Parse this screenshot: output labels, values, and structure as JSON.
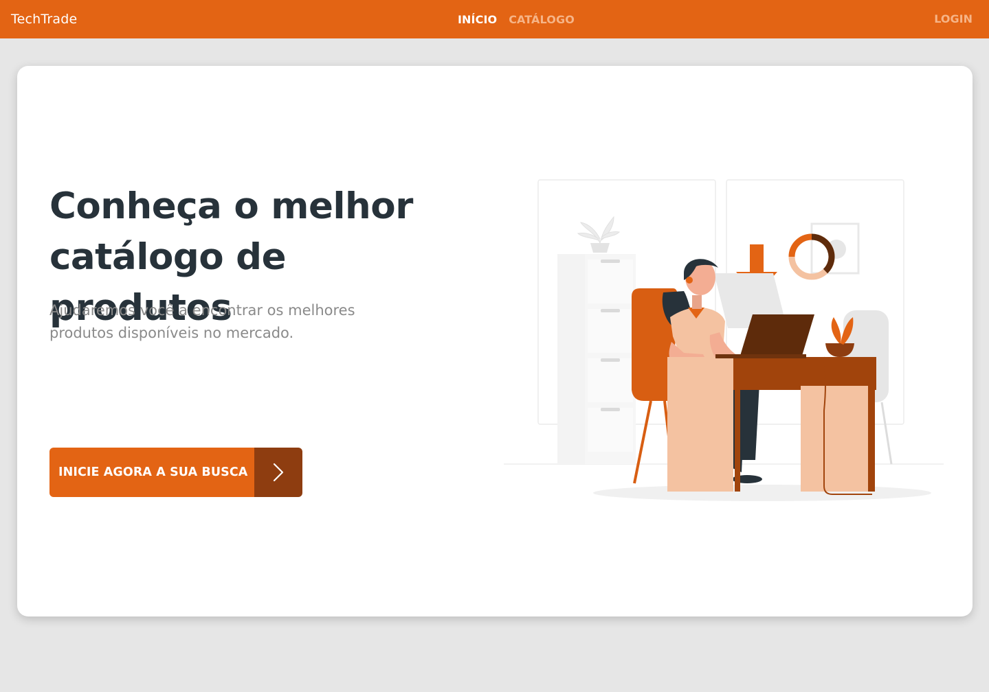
{
  "nav": {
    "brand": "TechTrade",
    "links": [
      {
        "label": "INÍCIO",
        "active": true
      },
      {
        "label": "CATÁLOGO",
        "active": false
      }
    ],
    "login_label": "LOGIN"
  },
  "hero": {
    "title_line1": "Conheça o melhor",
    "title_line2": "catálogo de produtos",
    "subtitle_line1": "Ajudaremos você a encontrar os melhores",
    "subtitle_line2": "produtos disponíveis no mercado.",
    "cta_label": "INICIE AGORA A SUA BUSCA",
    "cta_icon": "chevron-right-icon",
    "illustration": "woman-at-desk-with-laptop-illustration"
  },
  "colors": {
    "primary": "#e36414",
    "primary_dark": "#8e3d10",
    "text_dark": "#27323a",
    "text_muted": "#8a8a8a",
    "page_bg": "#e6e6e6"
  }
}
